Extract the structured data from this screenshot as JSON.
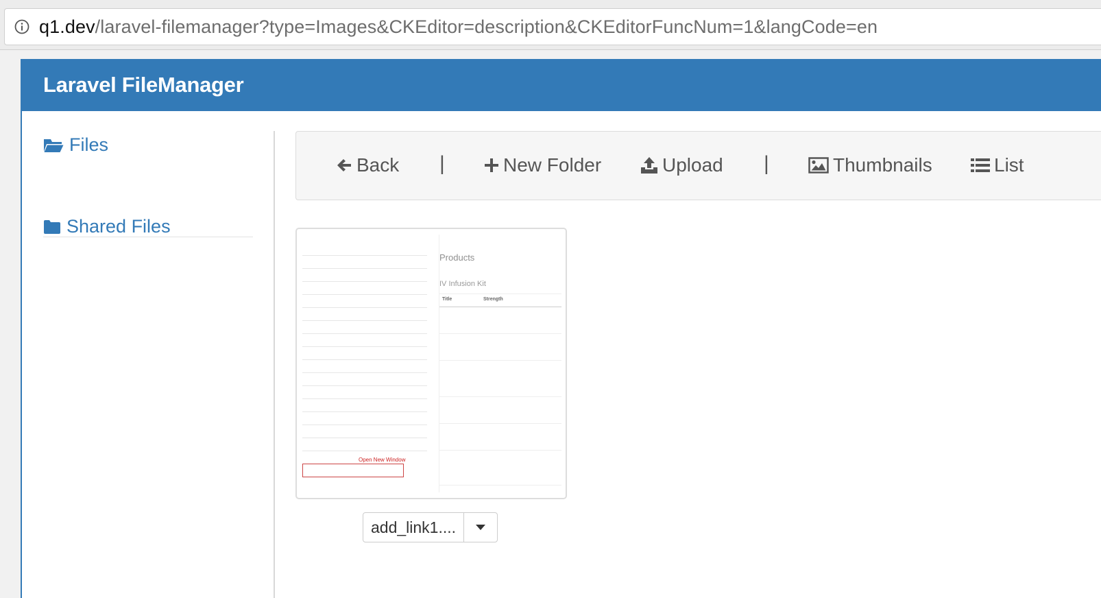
{
  "browser": {
    "url_host": "q1.dev",
    "url_rest": "/laravel-filemanager?type=Images&CKEditor=description&CKEditorFuncNum=1&langCode=en"
  },
  "app": {
    "title": "Laravel FileManager"
  },
  "sidebar": {
    "items": [
      {
        "label": "Files",
        "icon": "folder-open-icon"
      },
      {
        "label": "Shared Files",
        "icon": "folder-icon"
      }
    ]
  },
  "toolbar": {
    "back": "Back",
    "separator": "|",
    "new_folder": "New Folder",
    "upload": "Upload",
    "thumbnails": "Thumbnails",
    "list": "List"
  },
  "file": {
    "name": "add_link1...."
  },
  "preview": {
    "products": "Products",
    "kit": "IV Infusion Kit",
    "col_title": "Title",
    "col_strength": "Strength",
    "open_new_window": "Open New Window"
  },
  "colors": {
    "brand": "#337ab7",
    "panel": "#f6f6f6"
  }
}
